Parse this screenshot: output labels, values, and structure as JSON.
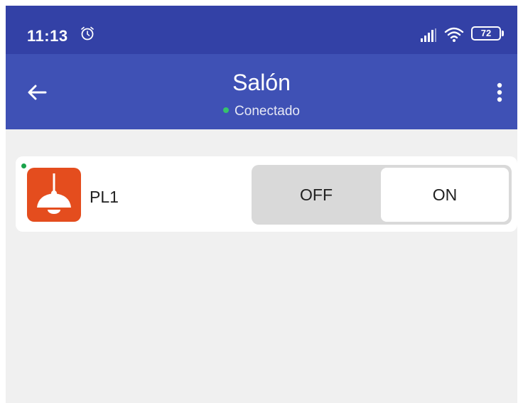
{
  "status_bar": {
    "time": "11:13",
    "alarm_icon": "alarm-clock-icon",
    "signal_icon": "cell-signal-icon",
    "wifi_icon": "wifi-icon",
    "battery_level": "72"
  },
  "app_bar": {
    "title": "Salón",
    "subtitle": "Conectado",
    "connection_color": "#36c26b",
    "back_icon": "arrow-left-icon",
    "menu_icon": "more-vertical-icon",
    "background": "#3f51b5"
  },
  "devices": [
    {
      "name": "PL1",
      "icon": "ceiling-lamp-icon",
      "icon_color": "#e44d1e",
      "online": true,
      "state_options": [
        "OFF",
        "ON"
      ],
      "selected_state": "ON"
    }
  ]
}
